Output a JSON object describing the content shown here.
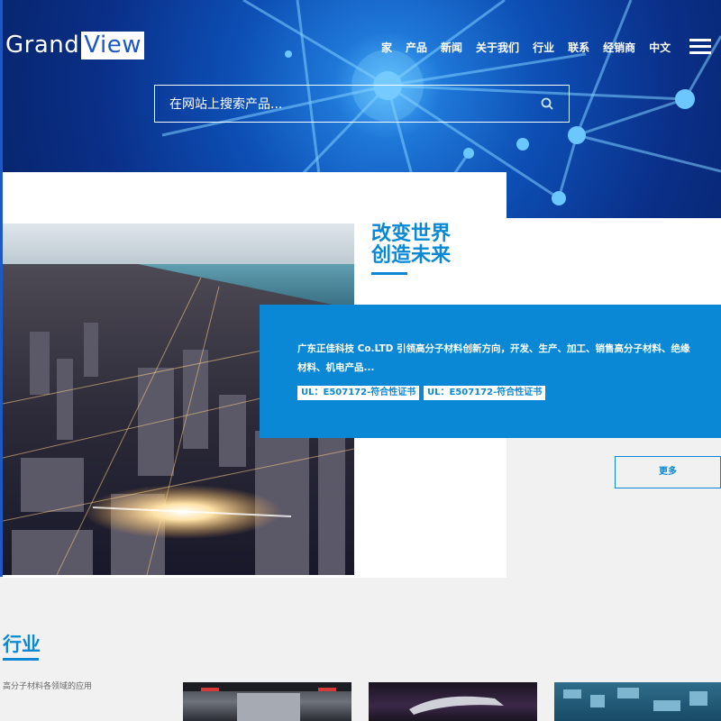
{
  "header": {
    "logo": {
      "part1": "Grand",
      "part2": "View"
    },
    "nav": [
      "家",
      "产品",
      "新闻",
      "关于我们",
      "行业",
      "联系",
      "经销商",
      "中文"
    ],
    "search": {
      "placeholder": "在网站上搜索产品..."
    }
  },
  "feature": {
    "headline_line1": "改变世界",
    "headline_line2": "创造未来",
    "description": "广东正佳科技 Co.LTD 引领高分子材料创新方向，开发、生产、加工、销售高分子材料、绝缘材料、机电产品...",
    "badges": [
      "UL：E507172-符合性证书",
      "UL：E507172-符合性证书"
    ],
    "more_button": "更多"
  },
  "industry": {
    "title": "行业",
    "subtitle": "高分子材料各领域的应用"
  },
  "colors": {
    "accent": "#0a88d6",
    "brand_blue": "#1a56c8"
  },
  "icons": {
    "search": "search-icon",
    "menu": "hamburger-menu-icon"
  }
}
